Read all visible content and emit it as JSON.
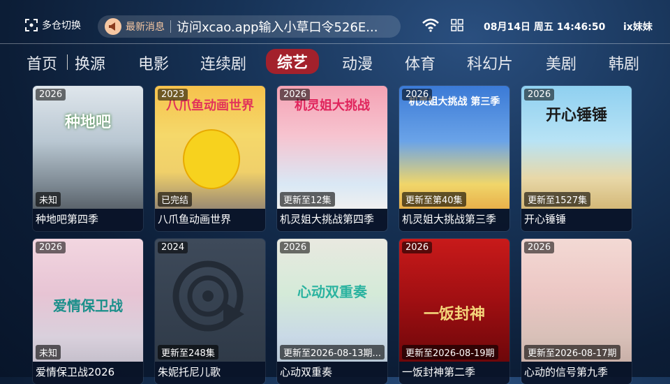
{
  "header": {
    "switch_label": "多仓切换",
    "notice_label": "最新消息",
    "notice_text": "访问xcao.app输入小草口令526E...",
    "datetime": "08月14日 周五 14:46:50",
    "user": "ix妹妹"
  },
  "nav": {
    "items": [
      "首页",
      "换源",
      "电影",
      "连续剧",
      "综艺",
      "动漫",
      "体育",
      "科幻片",
      "美剧",
      "韩剧"
    ],
    "active": "综艺"
  },
  "cards": [
    {
      "year": "2026",
      "status": "未知",
      "title": "种地吧第四季",
      "poster_text": "种地吧"
    },
    {
      "year": "2023",
      "status": "已完结",
      "title": "八爪鱼动画世界",
      "poster_text": "八爪鱼动画世界"
    },
    {
      "year": "2026",
      "status": "更新至12集",
      "title": "机灵姐大挑战第四季",
      "poster_text": "机灵姐大挑战"
    },
    {
      "year": "2026",
      "status": "更新至第40集",
      "title": "机灵姐大挑战第三季",
      "poster_text": "机灵姐大挑战 第三季"
    },
    {
      "year": "2026",
      "status": "更新至1527集",
      "title": "开心锤锤",
      "poster_text": "开心锤锤"
    },
    {
      "year": "2026",
      "status": "未知",
      "title": "爱情保卫战2026",
      "poster_text": "爱情保卫战"
    },
    {
      "year": "2024",
      "status": "更新至248集",
      "title": "朱妮托尼儿歌",
      "poster_text": ""
    },
    {
      "year": "2026",
      "status": "更新至2026-08-13期...",
      "title": "心动双重奏",
      "poster_text": "心动双重奏"
    },
    {
      "year": "2026",
      "status": "更新至2026-08-19期",
      "title": "一饭封神第二季",
      "poster_text": "一饭封神"
    },
    {
      "year": "2026",
      "status": "更新至2026-08-17期",
      "title": "心动的信号第九季",
      "poster_text": ""
    }
  ],
  "colors": {
    "active_tab": "#a3212c",
    "notice_accent": "#f6c7a2"
  }
}
